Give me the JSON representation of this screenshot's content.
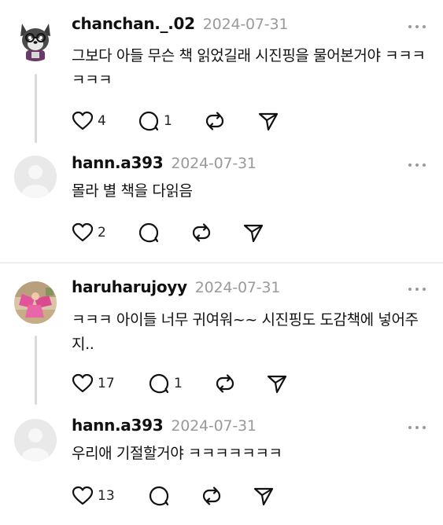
{
  "posts": [
    {
      "username": "chanchan._.02",
      "date": "2024-07-31",
      "text": "그보다 아들 무슨 책 읽었길래 시진핑을 물어본거야 ㅋㅋㅋㅋㅋㅋ",
      "likes": "4",
      "replies": "1",
      "avatar": "wolf-character-avatar"
    },
    {
      "username": "hann.a393",
      "date": "2024-07-31",
      "text": "몰라 별 책을 다읽음",
      "likes": "2",
      "replies": "",
      "avatar": "default-avatar"
    },
    {
      "username": "haruharujoyy",
      "date": "2024-07-31",
      "text": "ㅋㅋㅋ 아이들 너무 귀여워~~ 시진핑도 도감책에 넣어주지..",
      "likes": "17",
      "replies": "1",
      "avatar": "photo-avatar"
    },
    {
      "username": "hann.a393",
      "date": "2024-07-31",
      "text": "우리애 기절할거야 ㅋㅋㅋㅋㅋㅋㅋ",
      "likes": "13",
      "replies": "",
      "avatar": "default-avatar"
    }
  ],
  "icons": {
    "like": "heart-icon",
    "reply": "speech-bubble-icon",
    "repost": "repost-icon",
    "share": "send-icon",
    "more": "more-dots-icon"
  }
}
